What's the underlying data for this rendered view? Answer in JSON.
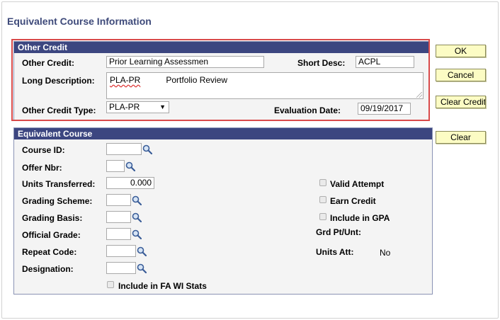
{
  "page": {
    "title": "Equivalent Course Information"
  },
  "other_credit": {
    "header": "Other Credit",
    "other_credit_label": "Other Credit:",
    "other_credit_value": "Prior Learning Assessmen",
    "short_desc_label": "Short Desc:",
    "short_desc_value": "ACPL",
    "long_desc_label": "Long Description:",
    "long_desc_code": "PLA-PR",
    "long_desc_text": "Portfolio Review",
    "type_label": "Other Credit Type:",
    "type_value": "PLA-PR",
    "eval_date_label": "Evaluation Date:",
    "eval_date_value": "09/19/2017"
  },
  "equivalent_course": {
    "header": "Equivalent Course",
    "course_id_label": "Course ID:",
    "offer_nbr_label": "Offer Nbr:",
    "units_transferred_label": "Units Transferred:",
    "units_transferred_value": "0.000",
    "grading_scheme_label": "Grading Scheme:",
    "grading_basis_label": "Grading Basis:",
    "official_grade_label": "Official Grade:",
    "repeat_code_label": "Repeat Code:",
    "designation_label": "Designation:",
    "include_fa_label": "Include in FA WI Stats",
    "valid_attempt_label": "Valid Attempt",
    "earn_credit_label": "Earn Credit",
    "include_gpa_label": "Include in GPA",
    "grd_pt_label": "Grd Pt/Unt:",
    "units_att_label": "Units Att:",
    "units_att_value": "No"
  },
  "buttons": {
    "ok": "OK",
    "cancel": "Cancel",
    "clear_credit": "Clear Credit",
    "clear": "Clear"
  },
  "icons": {
    "lookup": "magnifier-icon",
    "dropdown": "chevron-down-icon"
  },
  "colors": {
    "header_bg": "#3c4680",
    "title": "#3e4a7a",
    "highlight": "#d94a4a",
    "button_bg": "#fcfcc4"
  }
}
